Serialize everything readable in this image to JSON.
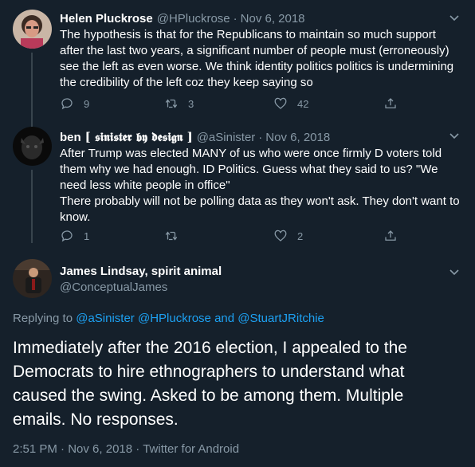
{
  "tweets": [
    {
      "name": "Helen Pluckrose",
      "handle": "@HPluckrose",
      "date": "Nov 6, 2018",
      "text": "The hypothesis is that for the Republicans to maintain so much support after the last two years, a significant number of people must (erroneously) see the left as even worse. We think identity politics politics is undermining the credibility of the left coz they keep saying so",
      "replies": "9",
      "retweets": "3",
      "likes": "42"
    },
    {
      "name": "ben",
      "name_fancy": "[ 𝖘𝖎𝖓𝖎𝖘𝖙𝖊𝖗 𝖇𝖞 𝖉𝖊𝖘𝖎𝖌𝖓 ]",
      "handle": "@aSinister",
      "date": "Nov 6, 2018",
      "text": "After Trump was elected MANY of us who were once firmly D voters told them why we had enough. ID Politics. Guess what they said to us? \"We need less white people in office\"\nThere probably will not be polling data as they won't ask. They don't want to know.",
      "replies": "1",
      "retweets": "",
      "likes": "2"
    }
  ],
  "main": {
    "name": "James Lindsay, spirit animal",
    "handle": "@ConceptualJames",
    "replying_prefix": "Replying to",
    "replying_users": [
      "@aSinister",
      "@HPluckrose"
    ],
    "replying_and": "and",
    "replying_last": "@StuartJRitchie",
    "text": "Immediately after the 2016 election, I appealed to the Democrats to hire ethnographers to understand what caused the swing. Asked to be among them. Multiple emails. No responses.",
    "time": "2:51 PM",
    "date": "Nov 6, 2018",
    "source": "Twitter for Android"
  }
}
